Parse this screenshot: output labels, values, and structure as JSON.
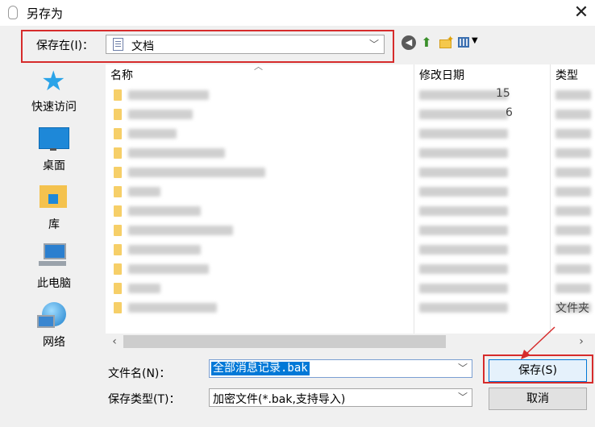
{
  "window": {
    "title": "另存为",
    "close_glyph": "✕"
  },
  "location": {
    "label": "保存在(I)：",
    "value": "文档"
  },
  "toolbar": {
    "back_glyph": "◀",
    "up_glyph": "⬆",
    "view_arrow": "▼"
  },
  "places": [
    {
      "label": "快速访问",
      "icon": "quick-access-star-icon"
    },
    {
      "label": "桌面",
      "icon": "desktop-icon"
    },
    {
      "label": "库",
      "icon": "library-icon"
    },
    {
      "label": "此电脑",
      "icon": "this-pc-icon"
    },
    {
      "label": "网络",
      "icon": "network-icon"
    }
  ],
  "file_list": {
    "columns": [
      "名称",
      "修改日期",
      "类型"
    ],
    "visible_fragments": {
      "row1_date": "15",
      "row2_date": "6",
      "last_type": "文件夹"
    }
  },
  "filename": {
    "label": "文件名(N)：",
    "value": "全部消息记录.bak"
  },
  "filetype": {
    "label": "保存类型(T)：",
    "value": "加密文件(*.bak,支持导入)"
  },
  "buttons": {
    "save": "保存(S)",
    "cancel": "取消"
  },
  "colors": {
    "highlight_red": "#d62b2b",
    "selection_blue": "#0078d7"
  }
}
